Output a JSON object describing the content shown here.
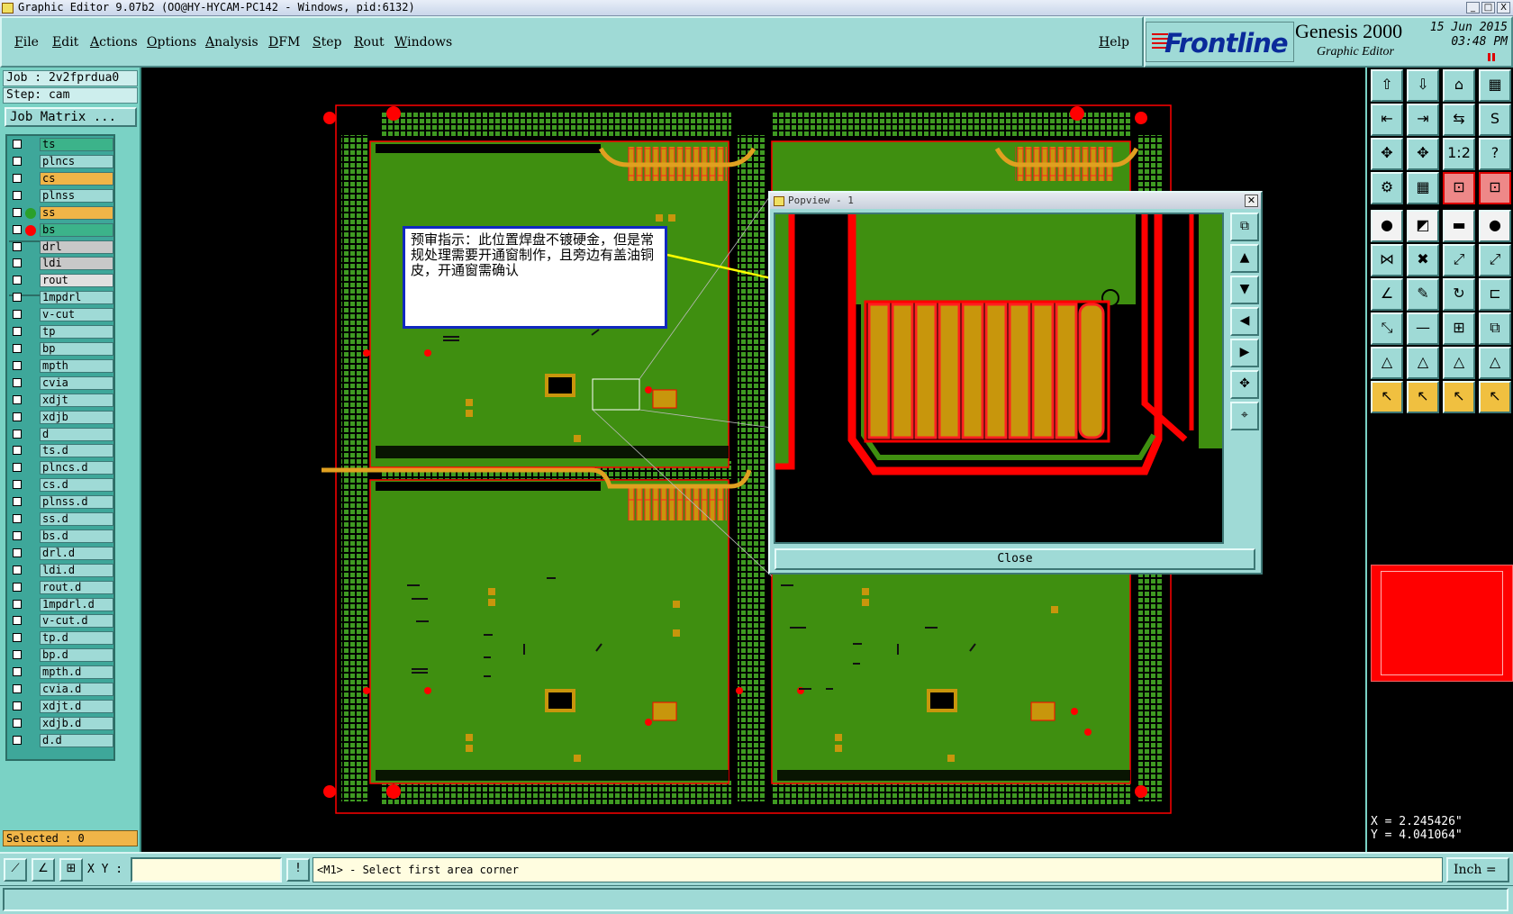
{
  "window": {
    "title": "Graphic Editor 9.07b2 (OO@HY-HYCAM-PC142 - Windows, pid:6132)",
    "min": "_",
    "max": "□",
    "close": "X"
  },
  "menu": {
    "items": [
      "File",
      "Edit",
      "Actions",
      "Options",
      "Analysis",
      "DFM",
      "Step",
      "Rout",
      "Windows"
    ],
    "help": "Help"
  },
  "brand": {
    "logo": "Frontline",
    "product": "Genesis 2000",
    "subtitle": "Graphic Editor",
    "date": "15 Jun 2015",
    "time": "03:48 PM"
  },
  "job": {
    "job_label": "Job : 2v2fprdua0",
    "step_label": "Step: cam",
    "matrix_button": "Job Matrix ..."
  },
  "layers": [
    {
      "name": "ts",
      "color": "#3cb38a",
      "dot": ""
    },
    {
      "name": "plncs",
      "color": "#9fdad6",
      "dot": ""
    },
    {
      "name": "cs",
      "color": "#f0b548",
      "dot": ""
    },
    {
      "name": "plnss",
      "color": "#9fdad6",
      "dot": ""
    },
    {
      "name": "ss",
      "color": "#f0b548",
      "dot": "#2aa02a"
    },
    {
      "name": "bs",
      "color": "#3cb38a",
      "dot": "#ff0000"
    },
    {
      "name": "drl",
      "color": "#c8c8c8",
      "dot": ""
    },
    {
      "name": "ldi",
      "color": "#c8c8c8",
      "dot": ""
    },
    {
      "name": "rout",
      "color": "#e0e0e0",
      "dot": ""
    },
    {
      "name": "1mpdrl",
      "color": "#9fdad6",
      "dot": ""
    },
    {
      "name": "v-cut",
      "color": "#9fdad6",
      "dot": ""
    },
    {
      "name": "tp",
      "color": "#9fdad6",
      "dot": ""
    },
    {
      "name": "bp",
      "color": "#9fdad6",
      "dot": ""
    },
    {
      "name": "mpth",
      "color": "#9fdad6",
      "dot": ""
    },
    {
      "name": "cvia",
      "color": "#9fdad6",
      "dot": ""
    },
    {
      "name": "xdjt",
      "color": "#9fdad6",
      "dot": ""
    },
    {
      "name": "xdjb",
      "color": "#9fdad6",
      "dot": ""
    },
    {
      "name": "d",
      "color": "#9fdad6",
      "dot": ""
    },
    {
      "name": "ts.d",
      "color": "#9fdad6",
      "dot": ""
    },
    {
      "name": "plncs.d",
      "color": "#9fdad6",
      "dot": ""
    },
    {
      "name": "cs.d",
      "color": "#9fdad6",
      "dot": ""
    },
    {
      "name": "plnss.d",
      "color": "#9fdad6",
      "dot": ""
    },
    {
      "name": "ss.d",
      "color": "#9fdad6",
      "dot": ""
    },
    {
      "name": "bs.d",
      "color": "#9fdad6",
      "dot": ""
    },
    {
      "name": "drl.d",
      "color": "#9fdad6",
      "dot": ""
    },
    {
      "name": "ldi.d",
      "color": "#9fdad6",
      "dot": ""
    },
    {
      "name": "rout.d",
      "color": "#9fdad6",
      "dot": ""
    },
    {
      "name": "1mpdrl.d",
      "color": "#9fdad6",
      "dot": ""
    },
    {
      "name": "v-cut.d",
      "color": "#9fdad6",
      "dot": ""
    },
    {
      "name": "tp.d",
      "color": "#9fdad6",
      "dot": ""
    },
    {
      "name": "bp.d",
      "color": "#9fdad6",
      "dot": ""
    },
    {
      "name": "mpth.d",
      "color": "#9fdad6",
      "dot": ""
    },
    {
      "name": "cvia.d",
      "color": "#9fdad6",
      "dot": ""
    },
    {
      "name": "xdjt.d",
      "color": "#9fdad6",
      "dot": ""
    },
    {
      "name": "xdjb.d",
      "color": "#9fdad6",
      "dot": ""
    },
    {
      "name": "d.d",
      "color": "#9fdad6",
      "dot": ""
    }
  ],
  "selected": "Selected : 0",
  "annotation": "预审指示：此位置焊盘不镀硬金，但是常规处理需要开通窗制作，且旁边有盖油铜皮，开通窗需确认",
  "popview": {
    "title": "Popview - 1",
    "close_label": "Close"
  },
  "coords": {
    "x": "X = 2.245426\"",
    "y": "Y = 4.041064\""
  },
  "bottom": {
    "xy_label": "X Y :",
    "xy_value": "",
    "prompt": "<M1> - Select first area corner",
    "units": "Inch"
  },
  "colors": {
    "panel": "#9fdad6",
    "board": "#3f8f10",
    "copper": "#c8960c",
    "outline": "#ff0000"
  },
  "toolbar_icons": [
    "zoom-in-icon",
    "zoom-out-icon",
    "home-icon",
    "pan-icon",
    "prev-icon",
    "next-icon",
    "fit-icon",
    "refresh-icon",
    "zoom-fit-icon",
    "zoom-center-icon",
    "scale-icon",
    "help-icon",
    "tools-icon",
    "grid-icon",
    "layer-red-icon",
    "layer-red2-icon",
    "pad-icon",
    "line-icon",
    "ruler-icon",
    "circle-icon",
    "net-icon",
    "cross-icon",
    "snap-icon",
    "snap2-icon",
    "angle-icon",
    "pencil-icon",
    "rotate-icon",
    "mirror-icon",
    "move-icon",
    "dash-icon",
    "measure-icon",
    "copy-icon",
    "triangle-icon",
    "triangle2-icon",
    "triangle3-icon",
    "triangle4-icon",
    "select-icon",
    "select2-icon",
    "select3-icon",
    "select4-icon"
  ]
}
